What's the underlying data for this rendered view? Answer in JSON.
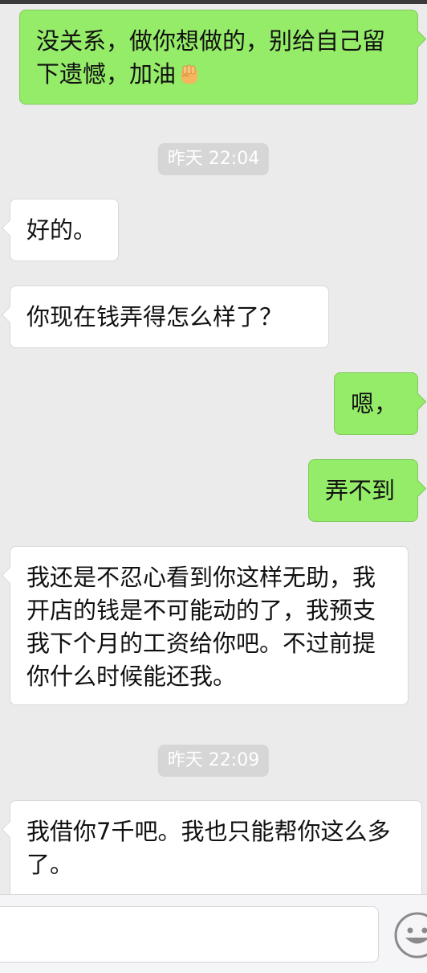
{
  "messages": [
    {
      "side": "out",
      "text": "没关系，做你想做的，别给自己留下遗憾，加油",
      "emoji": "fist-icon"
    },
    {
      "type": "timestamp",
      "text": "昨天 22:04"
    },
    {
      "side": "in",
      "text": "好的。"
    },
    {
      "side": "in",
      "text": "你现在钱弄得怎么样了？"
    },
    {
      "side": "out",
      "text": "嗯，"
    },
    {
      "side": "out",
      "text": "弄不到"
    },
    {
      "side": "in",
      "text": "我还是不忍心看到你这样无助，我开店的钱是不可能动的了，我预支我下个月的工资给你吧。不过前提你什么时候能还我。"
    },
    {
      "type": "timestamp",
      "text": "昨天 22:09"
    },
    {
      "side": "in",
      "text": "我借你7千吧。我也只能帮你这么多了。"
    }
  ],
  "input": {
    "placeholder": "",
    "emoji_button_icon": "smiley-icon"
  },
  "colors": {
    "background": "#ebebeb",
    "out_bubble": "#95ec69",
    "in_bubble": "#ffffff",
    "timestamp_bg": "#d6d6d6"
  }
}
